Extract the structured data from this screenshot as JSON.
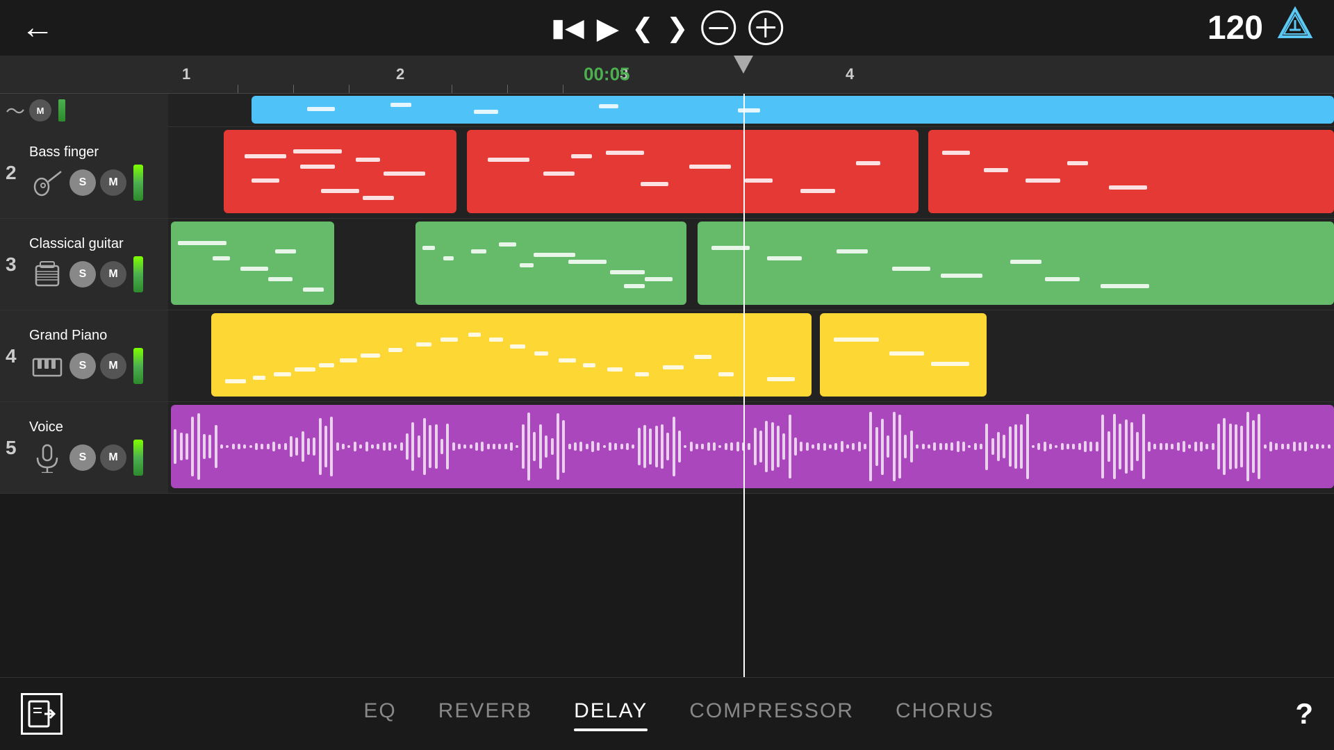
{
  "header": {
    "back_label": "←",
    "bpm": "120",
    "time_display": "00:05"
  },
  "controls": {
    "rewind": "⏮",
    "play": "▶",
    "prev": "❮",
    "next": "❯",
    "zoom_out": "−",
    "zoom_in": "+"
  },
  "ruler": {
    "marks": [
      "1",
      "2",
      "3",
      "4"
    ]
  },
  "tracks": [
    {
      "id": 1,
      "number": "",
      "name": "",
      "color": "blue",
      "type": "midi"
    },
    {
      "id": 2,
      "number": "2",
      "name": "Bass finger",
      "color": "red",
      "type": "midi"
    },
    {
      "id": 3,
      "number": "3",
      "name": "Classical guitar",
      "color": "green",
      "type": "midi"
    },
    {
      "id": 4,
      "number": "4",
      "name": "Grand Piano",
      "color": "yellow",
      "type": "midi"
    },
    {
      "id": 5,
      "number": "5",
      "name": "Voice",
      "color": "purple",
      "type": "audio"
    }
  ],
  "bottom_tabs": [
    {
      "id": "eq",
      "label": "EQ",
      "active": false
    },
    {
      "id": "reverb",
      "label": "REVERB",
      "active": false
    },
    {
      "id": "delay",
      "label": "DELAY",
      "active": true
    },
    {
      "id": "compressor",
      "label": "COMPRESSOR",
      "active": false
    },
    {
      "id": "chorus",
      "label": "CHORUS",
      "active": false
    }
  ],
  "buttons": {
    "s_label": "S",
    "m_label": "M",
    "help_label": "?"
  }
}
